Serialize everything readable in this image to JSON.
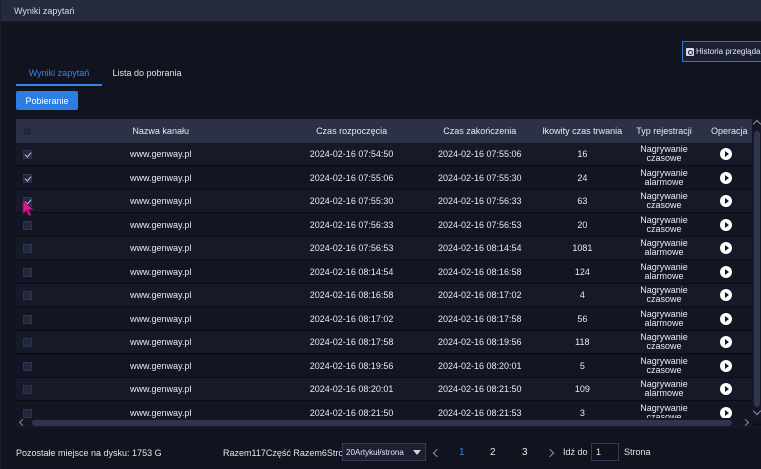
{
  "window": {
    "title": "Wyniki zapytań"
  },
  "history_button": {
    "label": "Historia przeglądania",
    "icon": "history-icon"
  },
  "tabs": [
    {
      "label": "Wyniki zapytań",
      "active": true
    },
    {
      "label": "Lista do pobrania",
      "active": false
    }
  ],
  "download_button": {
    "label": "Pobieranie"
  },
  "table": {
    "headers": {
      "channel": "Nazwa kanału",
      "start": "Czas rozpoczęcia",
      "end": "Czas zakończenia",
      "duration": "łkowity czas trwania",
      "type": "Typ rejestracji",
      "operation": "Operacja"
    },
    "rows": [
      {
        "checked": true,
        "channel": "www.genway.pl",
        "start": "2024-02-16 07:54:50",
        "end": "2024-02-16 07:55:06",
        "duration": "16",
        "type": "Nagrywanie czasowe"
      },
      {
        "checked": true,
        "channel": "www.genway.pl",
        "start": "2024-02-16 07:55:06",
        "end": "2024-02-16 07:55:30",
        "duration": "24",
        "type": "Nagrywanie alarmowe"
      },
      {
        "checked": true,
        "channel": "www.genway.pl",
        "start": "2024-02-16 07:55:30",
        "end": "2024-02-16 07:56:33",
        "duration": "63",
        "type": "Nagrywanie czasowe"
      },
      {
        "checked": false,
        "channel": "www.genway.pl",
        "start": "2024-02-16 07:56:33",
        "end": "2024-02-16 07:56:53",
        "duration": "20",
        "type": "Nagrywanie czasowe"
      },
      {
        "checked": false,
        "channel": "www.genway.pl",
        "start": "2024-02-16 07:56:53",
        "end": "2024-02-16 08:14:54",
        "duration": "1081",
        "type": "Nagrywanie alarmowe"
      },
      {
        "checked": false,
        "channel": "www.genway.pl",
        "start": "2024-02-16 08:14:54",
        "end": "2024-02-16 08:16:58",
        "duration": "124",
        "type": "Nagrywanie alarmowe"
      },
      {
        "checked": false,
        "channel": "www.genway.pl",
        "start": "2024-02-16 08:16:58",
        "end": "2024-02-16 08:17:02",
        "duration": "4",
        "type": "Nagrywanie czasowe"
      },
      {
        "checked": false,
        "channel": "www.genway.pl",
        "start": "2024-02-16 08:17:02",
        "end": "2024-02-16 08:17:58",
        "duration": "56",
        "type": "Nagrywanie alarmowe"
      },
      {
        "checked": false,
        "channel": "www.genway.pl",
        "start": "2024-02-16 08:17:58",
        "end": "2024-02-16 08:19:56",
        "duration": "118",
        "type": "Nagrywanie czasowe"
      },
      {
        "checked": false,
        "channel": "www.genway.pl",
        "start": "2024-02-16 08:19:56",
        "end": "2024-02-16 08:20:01",
        "duration": "5",
        "type": "Nagrywanie czasowe"
      },
      {
        "checked": false,
        "channel": "www.genway.pl",
        "start": "2024-02-16 08:20:01",
        "end": "2024-02-16 08:21:50",
        "duration": "109",
        "type": "Nagrywanie alarmowe"
      },
      {
        "checked": false,
        "channel": "www.genway.pl",
        "start": "2024-02-16 08:21:50",
        "end": "2024-02-16 08:21:53",
        "duration": "3",
        "type": "Nagrywanie czasowe"
      }
    ]
  },
  "footer": {
    "disk_space": "Pozostałe miejsce na dysku: 1753 G",
    "totals": "Razem117Część Razem6Strona",
    "per_page": "20Artykuł/strona",
    "pages": [
      "1",
      "2",
      "3"
    ],
    "current_page": "1",
    "goto_label": "Idź do",
    "goto_value": "1",
    "page_suffix": "Strona"
  },
  "colors": {
    "accent": "#3a86e8",
    "button": "#2b7de3",
    "background": "#11131e",
    "header": "#2c3146",
    "cursor": "#e0159c"
  }
}
